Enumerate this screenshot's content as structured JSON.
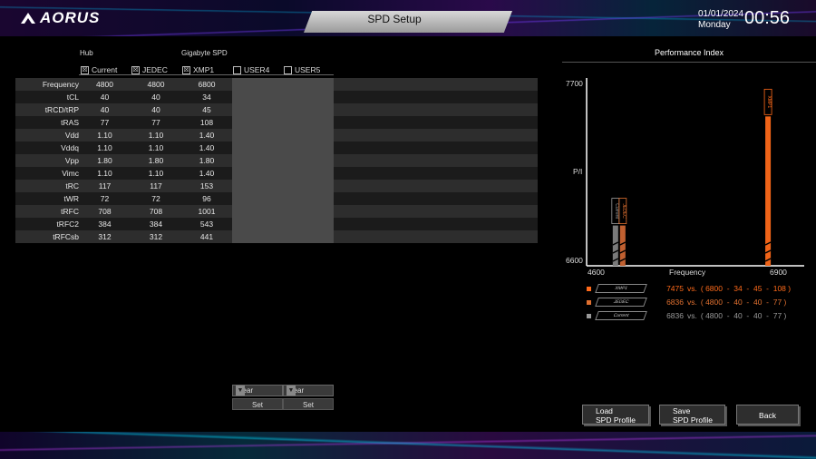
{
  "header": {
    "logo_text": "AORUS",
    "title": "SPD Setup",
    "date": "01/01/2024",
    "day": "Monday",
    "time": "00:56"
  },
  "table": {
    "col_hub": "Hub",
    "col_spd": "Gigabyte SPD",
    "profiles": [
      {
        "label": "Current",
        "checked": true,
        "mark": "☒"
      },
      {
        "label": "JEDEC",
        "checked": true,
        "mark": "☒"
      },
      {
        "label": "XMP1",
        "checked": true,
        "mark": "☒"
      },
      {
        "label": "USER4",
        "checked": false,
        "mark": ""
      },
      {
        "label": "USER5",
        "checked": false,
        "mark": ""
      }
    ],
    "rows": [
      {
        "name": "Frequency",
        "current": "4800",
        "jedec": "4800",
        "xmp1": "6800"
      },
      {
        "name": "tCL",
        "current": "40",
        "jedec": "40",
        "xmp1": "34"
      },
      {
        "name": "tRCD/tRP",
        "current": "40",
        "jedec": "40",
        "xmp1": "45"
      },
      {
        "name": "tRAS",
        "current": "77",
        "jedec": "77",
        "xmp1": "108"
      },
      {
        "name": "Vdd",
        "current": "1.10",
        "jedec": "1.10",
        "xmp1": "1.40"
      },
      {
        "name": "Vddq",
        "current": "1.10",
        "jedec": "1.10",
        "xmp1": "1.40"
      },
      {
        "name": "Vpp",
        "current": "1.80",
        "jedec": "1.80",
        "xmp1": "1.80"
      },
      {
        "name": "Vimc",
        "current": "1.10",
        "jedec": "1.10",
        "xmp1": "1.40"
      },
      {
        "name": "tRC",
        "current": "117",
        "jedec": "117",
        "xmp1": "153"
      },
      {
        "name": "tWR",
        "current": "72",
        "jedec": "72",
        "xmp1": "96"
      },
      {
        "name": "tRFC",
        "current": "708",
        "jedec": "708",
        "xmp1": "1001"
      },
      {
        "name": "tRFC2",
        "current": "384",
        "jedec": "384",
        "xmp1": "543"
      },
      {
        "name": "tRFCsb",
        "current": "312",
        "jedec": "312",
        "xmp1": "441"
      }
    ]
  },
  "controls": {
    "user4_select": "Clear",
    "user5_select": "Clear",
    "user4_set": "Set",
    "user5_set": "Set"
  },
  "performance": {
    "title": "Performance Index",
    "y_top": "7700",
    "y_bottom": "6600",
    "y_label": "P/I",
    "x_left": "4600",
    "x_right": "6900",
    "x_label": "Frequency",
    "bars": [
      {
        "name": "Current",
        "freq": 4800,
        "pi": 6836,
        "color": "#a0a0a0",
        "fill": "#7a7a7a"
      },
      {
        "name": "JEDEC",
        "freq": 4800,
        "pi": 6836,
        "color": "#e07030",
        "fill": "#c06030"
      },
      {
        "name": "XMP1",
        "freq": 6800,
        "pi": 7475,
        "color": "#ff6a1a",
        "fill": "#f06418"
      }
    ],
    "legend": [
      {
        "tag": "XMP1",
        "value": "7475",
        "vs": "vs.",
        "detail": "( 6800  -  34  -  45  -  108 )",
        "color": "#ff6a1a"
      },
      {
        "tag": "JEDEC",
        "value": "6836",
        "vs": "vs.",
        "detail": "( 4800  -  40  -  40  -  77 )",
        "color": "#e07030"
      },
      {
        "tag": "Current",
        "value": "6836",
        "vs": "vs.",
        "detail": "( 4800  -  40  -  40  -  77 )",
        "color": "#999999"
      }
    ]
  },
  "buttons": {
    "load_line1": "Load",
    "load_line2": "SPD Profile",
    "save_line1": "Save",
    "save_line2": "SPD Profile",
    "back": "Back"
  }
}
